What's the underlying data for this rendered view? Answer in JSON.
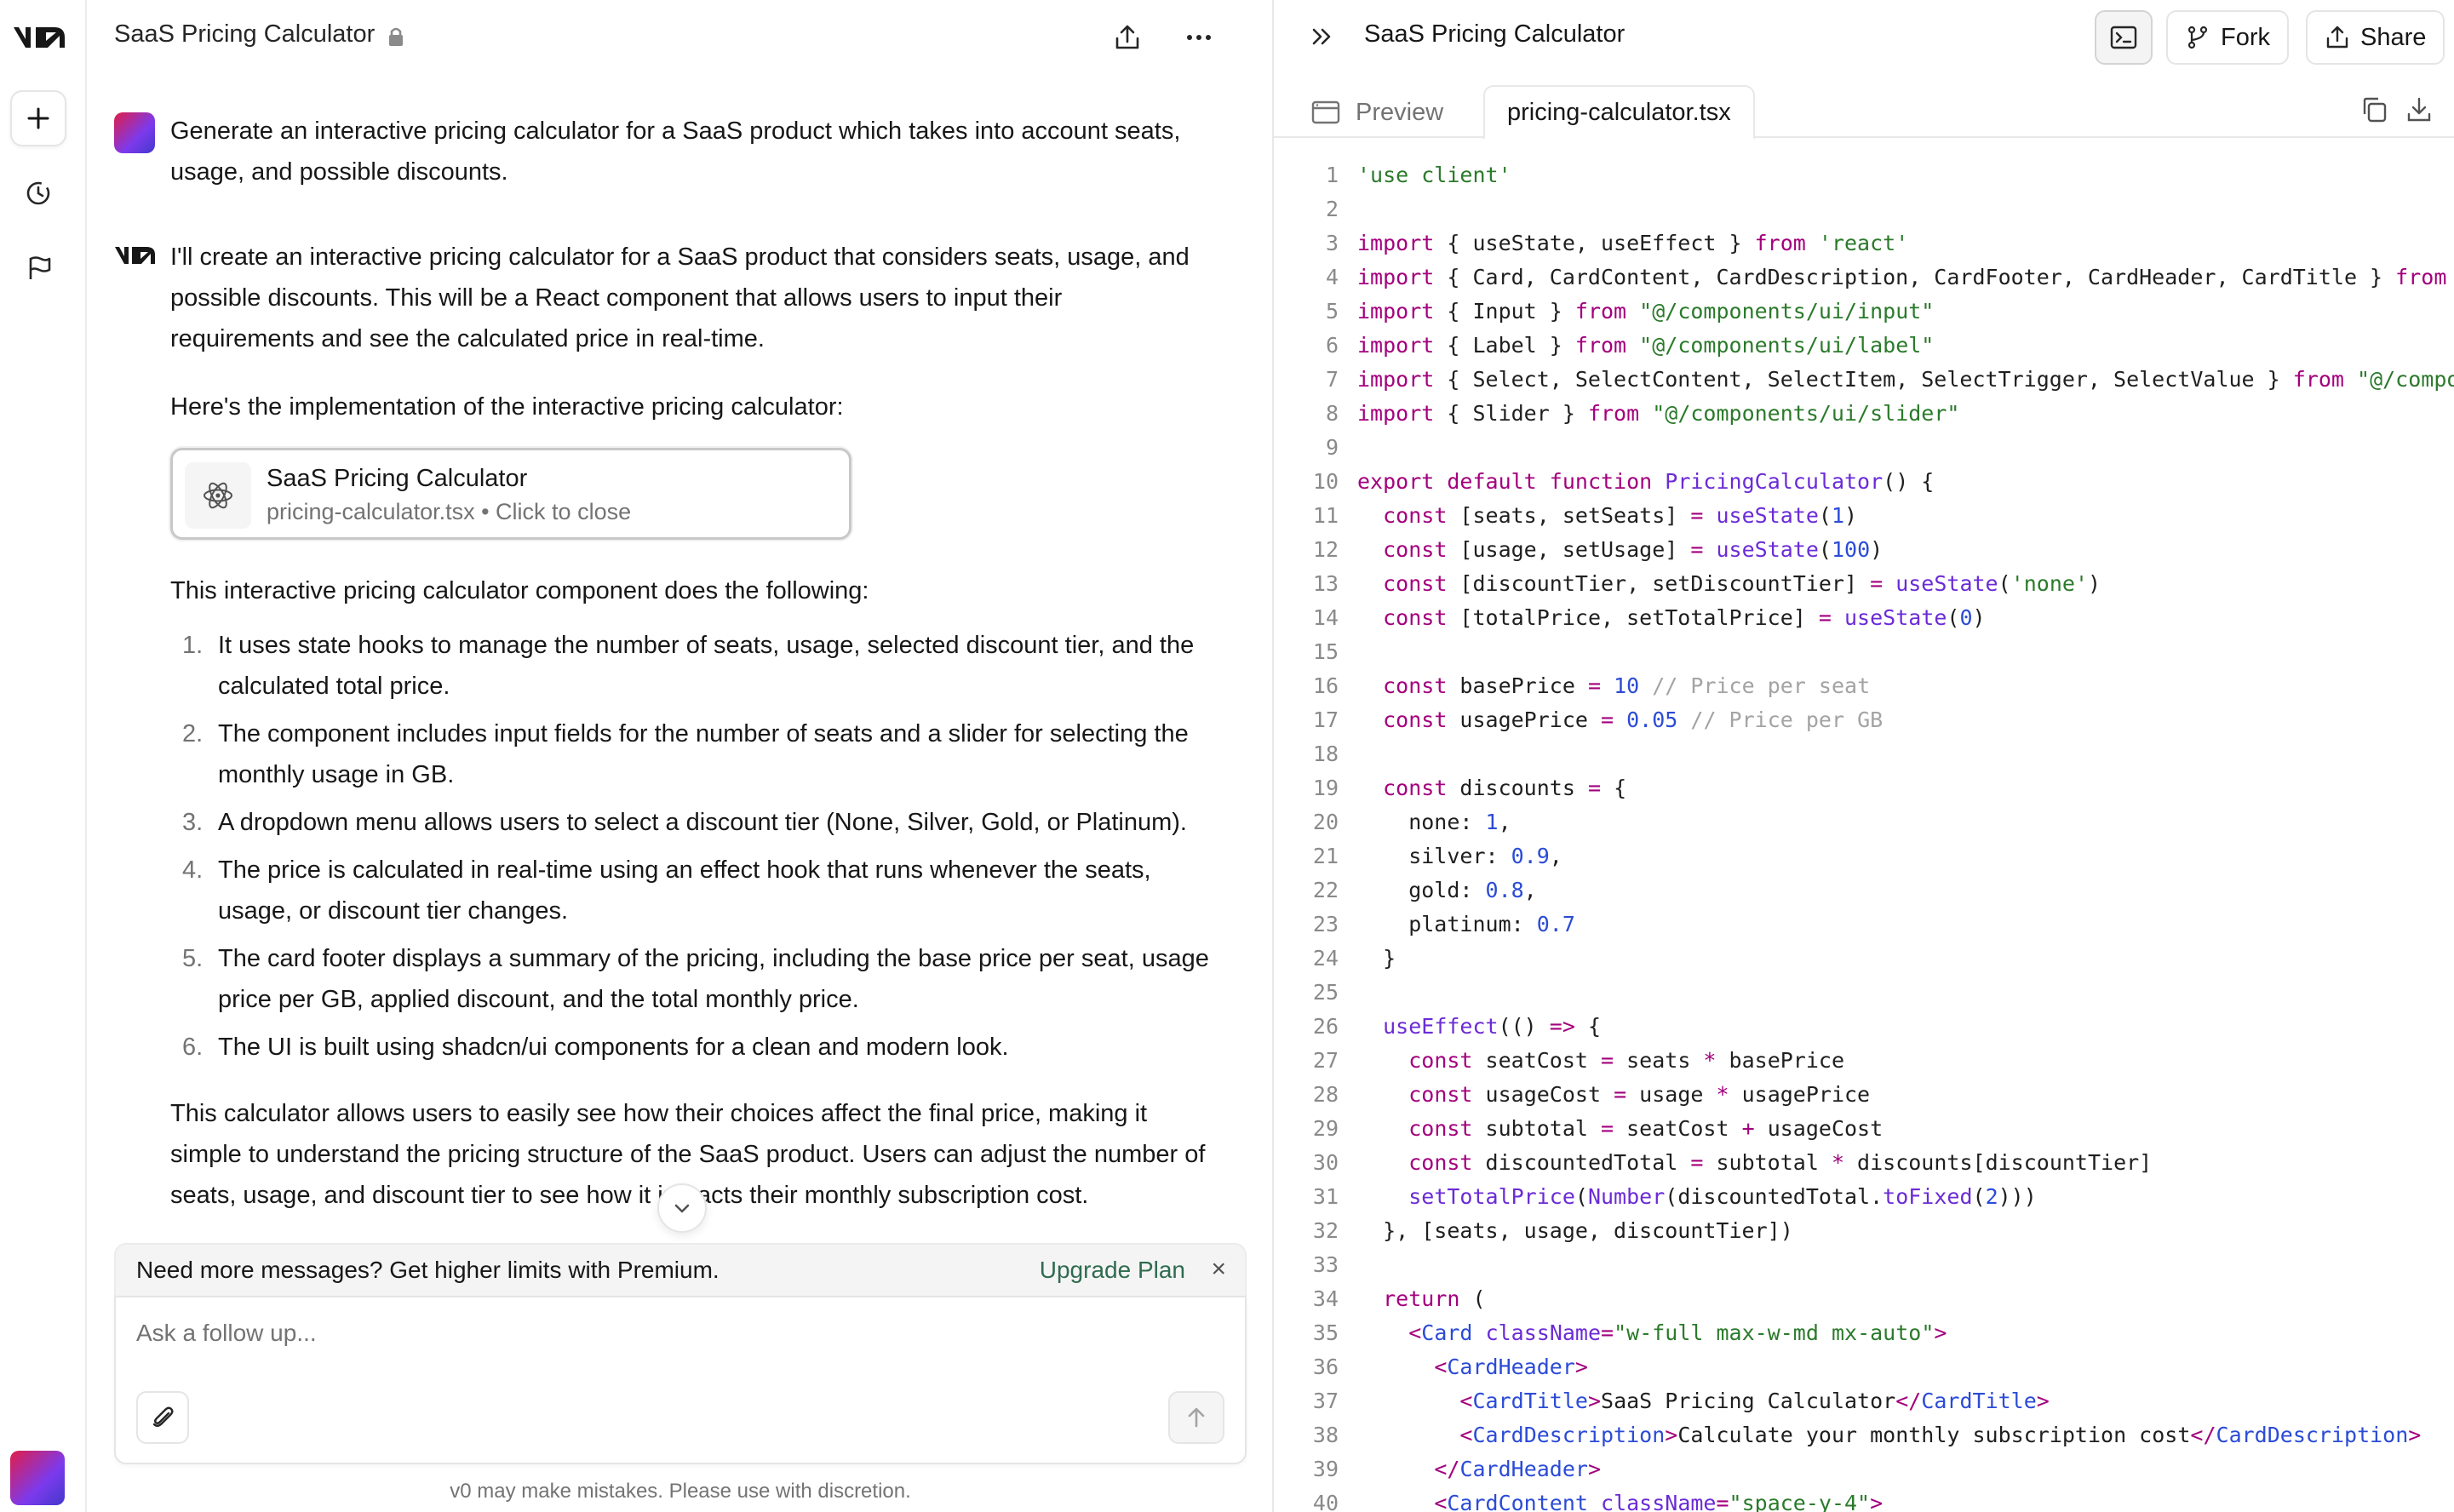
{
  "colors": {
    "accent_green": "#2f6b4f",
    "keyword": "#a3007d",
    "string": "#2b7a2b",
    "number": "#2b4bd6"
  },
  "rail": {
    "logo": "v0",
    "new_icon": "plus-icon",
    "history_icon": "history-icon",
    "flag_icon": "flag-icon"
  },
  "chat": {
    "title": "SaaS Pricing Calculator",
    "user_message": "Generate an interactive pricing calculator for a SaaS product which takes into account seats, usage, and possible discounts.",
    "ai_intro": "I'll create an interactive pricing calculator for a SaaS product that considers seats, usage, and possible discounts. This will be a React component that allows users to input their requirements and see the calculated price in real-time.",
    "ai_impl": "Here's the implementation of the interactive pricing calculator:",
    "artifact": {
      "title": "SaaS Pricing Calculator",
      "subtitle": "pricing-calculator.tsx • Click to close"
    },
    "ai_list_intro": "This interactive pricing calculator component does the following:",
    "list": [
      {
        "num": "1.",
        "text": "It uses state hooks to manage the number of seats, usage, selected discount tier, and the calculated total price."
      },
      {
        "num": "2.",
        "text": "The component includes input fields for the number of seats and a slider for selecting the monthly usage in GB."
      },
      {
        "num": "3.",
        "text": "A dropdown menu allows users to select a discount tier (None, Silver, Gold, or Platinum)."
      },
      {
        "num": "4.",
        "text": "The price is calculated in real-time using an effect hook that runs whenever the seats, usage, or discount tier changes."
      },
      {
        "num": "5.",
        "text": "The card footer displays a summary of the pricing, including the base price per seat, usage price per GB, applied discount, and the total monthly price."
      },
      {
        "num": "6.",
        "text": "The UI is built using shadcn/ui components for a clean and modern look."
      }
    ],
    "ai_outro": "This calculator allows users to easily see how their choices affect the final price, making it simple to understand the pricing structure of the SaaS product. Users can adjust the number of seats, usage, and discount tier to see how it impacts their monthly subscription cost.",
    "notice_text": "Need more messages? Get higher limits with Premium.",
    "notice_link": "Upgrade Plan",
    "notice_close": "×",
    "composer_placeholder": "Ask a follow up...",
    "disclaimer": "v0 may make mistakes. Please use with discretion."
  },
  "code_pane": {
    "title": "SaaS Pricing Calculator",
    "fork_label": "Fork",
    "share_label": "Share",
    "tab_preview": "Preview",
    "tab_file": "pricing-calculator.tsx",
    "lines": [
      "'use client'",
      "",
      "import { useState, useEffect } from 'react'",
      "import { Card, CardContent, CardDescription, CardFooter, CardHeader, CardTitle } from \"@/components/ui/card\"",
      "import { Input } from \"@/components/ui/input\"",
      "import { Label } from \"@/components/ui/label\"",
      "import { Select, SelectContent, SelectItem, SelectTrigger, SelectValue } from \"@/components/ui/select\"",
      "import { Slider } from \"@/components/ui/slider\"",
      "",
      "export default function PricingCalculator() {",
      "  const [seats, setSeats] = useState(1)",
      "  const [usage, setUsage] = useState(100)",
      "  const [discountTier, setDiscountTier] = useState('none')",
      "  const [totalPrice, setTotalPrice] = useState(0)",
      "",
      "  const basePrice = 10 // Price per seat",
      "  const usagePrice = 0.05 // Price per GB",
      "",
      "  const discounts = {",
      "    none: 1,",
      "    silver: 0.9,",
      "    gold: 0.8,",
      "    platinum: 0.7",
      "  }",
      "",
      "  useEffect(() => {",
      "    const seatCost = seats * basePrice",
      "    const usageCost = usage * usagePrice",
      "    const subtotal = seatCost + usageCost",
      "    const discountedTotal = subtotal * discounts[discountTier]",
      "    setTotalPrice(Number(discountedTotal.toFixed(2)))",
      "  }, [seats, usage, discountTier])",
      "",
      "  return (",
      "    <Card className=\"w-full max-w-md mx-auto\">",
      "      <CardHeader>",
      "        <CardTitle>SaaS Pricing Calculator</CardTitle>",
      "        <CardDescription>Calculate your monthly subscription cost</CardDescription>",
      "      </CardHeader>",
      "      <CardContent className=\"space-y-4\">"
    ]
  }
}
